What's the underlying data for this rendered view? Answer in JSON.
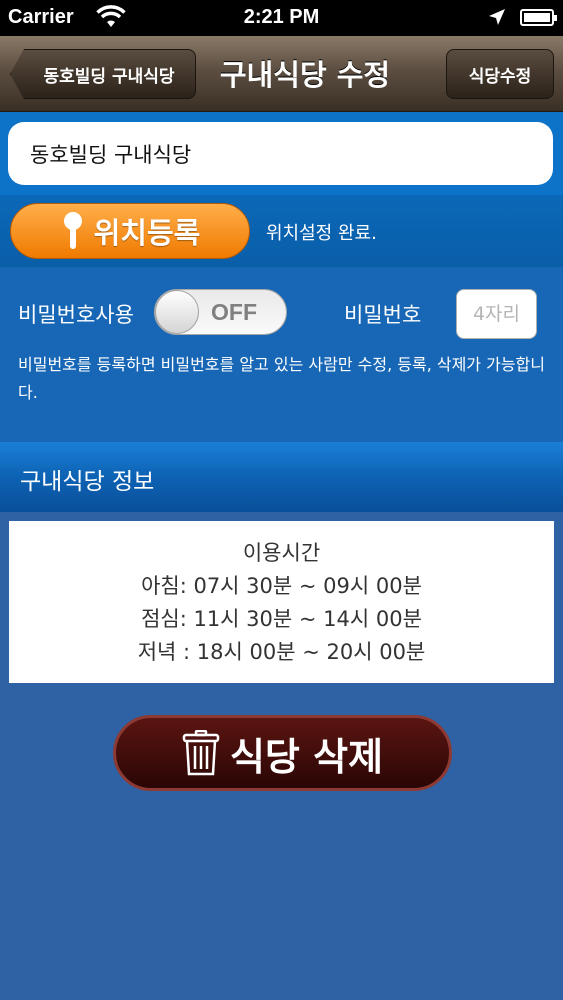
{
  "status_bar": {
    "carrier": "Carrier",
    "time": "2:21 PM",
    "icons": [
      "wifi-icon",
      "location-arrow-icon",
      "battery-icon"
    ]
  },
  "nav": {
    "back_label": "동호빌딩 구내식당",
    "title": "구내식당 수정",
    "right_label": "식당수정"
  },
  "cafeteria": {
    "name_value": "동호빌딩 구내식당"
  },
  "location": {
    "button_label": "위치등록",
    "status": "위치설정 완료."
  },
  "password": {
    "use_label": "비밀번호사용",
    "toggle_state": "OFF",
    "label": "비밀번호",
    "placeholder": "4자리",
    "note": "비밀번호를 등록하면 비밀번호를 알고 있는 사람만 수정, 등록, 삭제가 가능합니다."
  },
  "info": {
    "header": "구내식당 정보",
    "lines": [
      "이용시간",
      "아침: 07시 30분 ~ 09시 00분",
      "점심: 11시 30분 ~ 14시 00분",
      "저녁 : 18시 00분 ~ 20시 00분"
    ]
  },
  "delete_button_label": "식당 삭제",
  "colors": {
    "background": "#2f62a4",
    "accent_orange": "#f07a00",
    "nav_brown": "#5c4e41",
    "delete_dark_red": "#3a0a08"
  }
}
